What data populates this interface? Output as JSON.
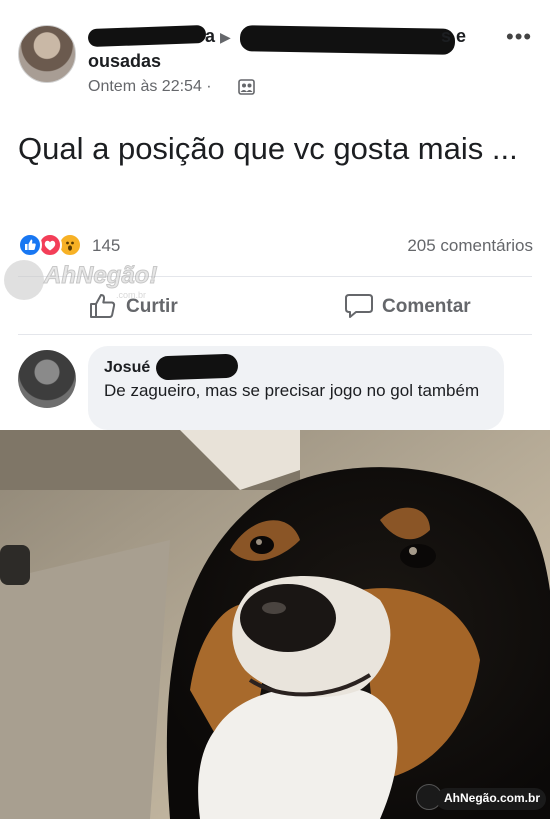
{
  "post": {
    "author_visible": "ra",
    "group_suffix": "s e",
    "group_line2": "ousadas",
    "timestamp": "Ontem às 22:54 ·",
    "text": "Qual a posição que vc gosta mais ...",
    "more_menu": "•••",
    "arrow": "▶"
  },
  "reactions": {
    "types": [
      "like-icon",
      "love-icon",
      "wow-icon"
    ],
    "count": "145",
    "comments": "205 comentários"
  },
  "actions": {
    "like_label": "Curtir",
    "comment_label": "Comentar"
  },
  "comment": {
    "author": "Josué",
    "text": "De zagueiro, mas se precisar jogo no gol também"
  },
  "watermarks": {
    "top_text": "AhNegão!",
    "top_sub": ".com.br",
    "bottom_text": "AhNegão.com.br"
  },
  "colors": {
    "like": "#1877f2",
    "love": "#f33e58",
    "wow": "#f7b125",
    "muted": "#65676b",
    "bubble": "#f0f2f5"
  }
}
